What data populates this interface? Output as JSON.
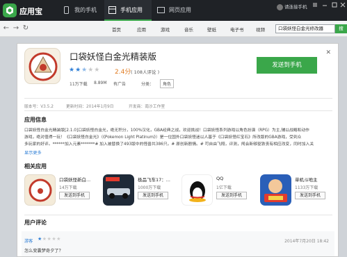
{
  "titlebar": {
    "app_name": "应用宝",
    "tabs": [
      {
        "label": "我的手机"
      },
      {
        "label": "手机应用"
      },
      {
        "label": "网页应用"
      }
    ],
    "login_text": "请连接手机"
  },
  "navbar": {
    "links": [
      "首页",
      "应用",
      "游戏",
      "音乐",
      "壁纸",
      "电子书",
      "视频"
    ],
    "search_value": "口袋妖怪白金光修改器",
    "search_button": "搜"
  },
  "app": {
    "name": "口袋妖怪白金光精装版",
    "stars_filled": 2.5,
    "stars_total": 5,
    "score": "2.4分",
    "reviews": "( 108人评论 )",
    "downloads": "11万下载",
    "size": "8.89M",
    "ads": "有广告",
    "category_label": "分类：",
    "category": "角色",
    "send_button": "发送到手机",
    "version": "版本号：V3.5.2",
    "update_time": "更新时间：2014年1月9日",
    "developer": "开发商：南沙工作室"
  },
  "sections": {
    "info_title": "应用信息",
    "related_title": "相关应用",
    "reviews_title": "用户评论"
  },
  "description": [
    "口袋妖怪白金光精装版[2.1.0]口袋妖怪白金光，绝无积分，100%汉化，GBA经典之战，欢迎挑战！口袋妖怪系列游戏以角色扮演（RPG）为主,辅以战略和动作",
    "游戏，绝对值得一玩！《口袋妖怪白金光》（《Pokemon Light Platinum》）是一位国外口袋妖怪迷以人基于《口袋妖怪红宝石》所改版的GBA游戏，受到众",
    "多玩家的好评。******加入元素*******# 加入被替换了493版中的怪兽共386只。# 原创新剧情。# 可自由飞翔，评测，闯会新够驱铁丧有相应改变，同时加入关"
  ],
  "show_more": "显示更多",
  "related": [
    {
      "name": "口袋妖怪新白...",
      "downloads": "14万下载",
      "send": "发送到手机",
      "icon": "pokemon-icon",
      "color": "#f4ebd9"
    },
    {
      "name": "极品飞车17：...",
      "downloads": "1000万下载",
      "send": "发送到手机",
      "icon": "race-car-icon",
      "color": "#1f2a38"
    },
    {
      "name": "QQ",
      "downloads": "1亿下载",
      "send": "发送到手机",
      "icon": "qq-penguin-icon",
      "color": "#ffffff"
    },
    {
      "name": "单机斗地主",
      "downloads": "1133万下载",
      "send": "发送到手机",
      "icon": "doudizhu-icon",
      "color": "#2a5fb8"
    }
  ],
  "review": {
    "user": "游客",
    "stars": 1,
    "date": "2014年7月20日 18:42",
    "text": "怎么变囊梦奇夕了？"
  }
}
